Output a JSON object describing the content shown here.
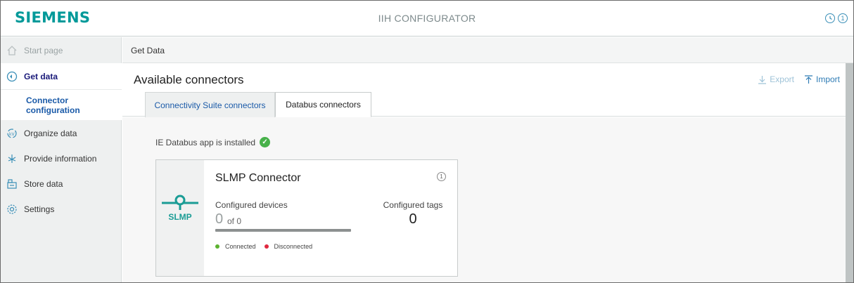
{
  "header": {
    "logo": "SIEMENS",
    "title": "IIH CONFIGURATOR",
    "icons": [
      "help-icon",
      "info-icon"
    ],
    "info_glyph": "1"
  },
  "sidebar": {
    "items": [
      {
        "label": "Start page",
        "icon": "home-icon"
      },
      {
        "label": "Get data",
        "icon": "get-data-icon"
      },
      {
        "label": "Connector configuration",
        "icon": ""
      },
      {
        "label": "Organize data",
        "icon": "organize-data-icon"
      },
      {
        "label": "Provide information",
        "icon": "provide-information-icon"
      },
      {
        "label": "Store data",
        "icon": "store-data-icon"
      },
      {
        "label": "Settings",
        "icon": "settings-icon"
      }
    ]
  },
  "breadcrumb": "Get Data",
  "main": {
    "title": "Available connectors",
    "export_label": "Export",
    "import_label": "Import",
    "tabs": [
      {
        "label": "Connectivity Suite connectors",
        "active": false
      },
      {
        "label": "Databus connectors",
        "active": true
      }
    ],
    "status_text": "IE Databus app is installed"
  },
  "card": {
    "title": "SLMP Connector",
    "logo_text": "SLMP",
    "configured_devices_label": "Configured devices",
    "configured_devices_count": "0",
    "configured_devices_total": "of 0",
    "configured_tags_label": "Configured tags",
    "configured_tags_count": "0",
    "legend_connected": "Connected",
    "legend_disconnected": "Disconnected",
    "info_glyph": "1"
  },
  "colors": {
    "brand": "#009999",
    "accent": "#2f7cb5",
    "connected": "#5cb230",
    "disconnected": "#e0283f",
    "installed_check": "#47b14a"
  }
}
